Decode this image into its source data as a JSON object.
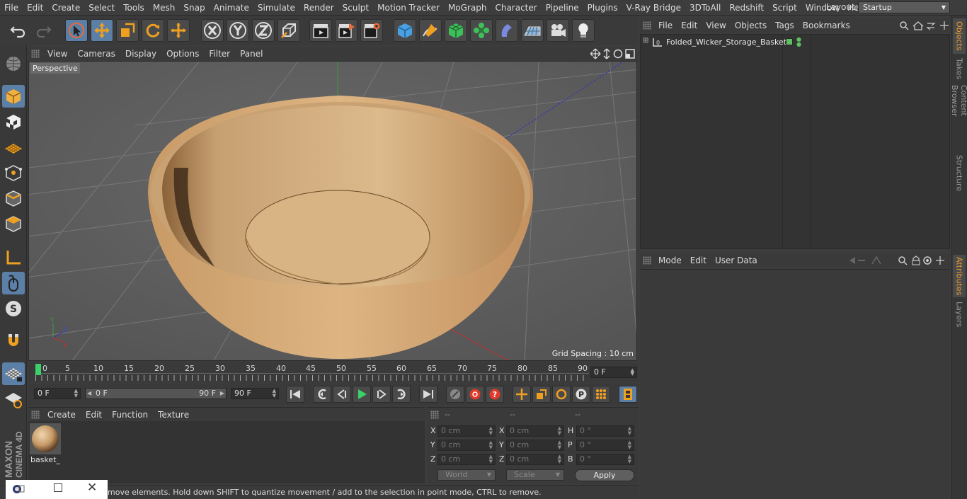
{
  "menubar": {
    "items": [
      "File",
      "Edit",
      "Create",
      "Select",
      "Tools",
      "Mesh",
      "Snap",
      "Animate",
      "Simulate",
      "Render",
      "Sculpt",
      "Motion Tracker",
      "MoGraph",
      "Character",
      "Pipeline",
      "Plugins",
      "V-Ray Bridge",
      "3DToAll",
      "Redshift",
      "Script",
      "Window",
      "Help"
    ],
    "layout_label": "Layout:",
    "layout_value": "Startup"
  },
  "viewport": {
    "menu": [
      "View",
      "Cameras",
      "Display",
      "Options",
      "Filter",
      "Panel"
    ],
    "label": "Perspective",
    "grid_spacing": "Grid Spacing : 10 cm"
  },
  "timeline": {
    "ticks": [
      "0",
      "5",
      "10",
      "15",
      "20",
      "25",
      "30",
      "35",
      "40",
      "45",
      "50",
      "55",
      "60",
      "65",
      "70",
      "75",
      "80",
      "85",
      "90"
    ],
    "current_frame": "0 F"
  },
  "playback": {
    "start": "0 F",
    "range_start": "0 F",
    "range_end": "90 F",
    "end": "90 F"
  },
  "materials": {
    "menu": [
      "Create",
      "Edit",
      "Function",
      "Texture"
    ],
    "items": [
      {
        "name": "basket_"
      }
    ]
  },
  "coordinates": {
    "headers": [
      "--",
      "--",
      "--"
    ],
    "rows": [
      {
        "l1": "X",
        "v1": "0 cm",
        "l2": "X",
        "v2": "0 cm",
        "l3": "H",
        "v3": "0 °"
      },
      {
        "l1": "Y",
        "v1": "0 cm",
        "l2": "Y",
        "v2": "0 cm",
        "l3": "P",
        "v3": "0 °"
      },
      {
        "l1": "Z",
        "v1": "0 cm",
        "l2": "Z",
        "v2": "0 cm",
        "l3": "B",
        "v3": "0 °"
      }
    ],
    "mode1": "World",
    "mode2": "Scale",
    "apply": "Apply"
  },
  "status": {
    "text": "move elements. Hold down SHIFT to quantize movement / add to the selection in point mode, CTRL to remove."
  },
  "objects": {
    "menu": [
      "File",
      "Edit",
      "View",
      "Objects",
      "Tags",
      "Bookmarks"
    ],
    "items": [
      {
        "name": "Folded_Wicker_Storage_Basket"
      }
    ]
  },
  "attributes": {
    "menu": [
      "Mode",
      "Edit",
      "User Data"
    ]
  },
  "side_tabs": [
    "Objects",
    "Takes",
    "Content Browser",
    "Structure",
    "Attributes",
    "Layers"
  ],
  "logo": {
    "line1": "MAXON",
    "line2": "CINEMA 4D"
  },
  "colors": {
    "accent": "#5b7fa6",
    "tab_active": "#f0a030",
    "basket": "#d8b07e"
  }
}
